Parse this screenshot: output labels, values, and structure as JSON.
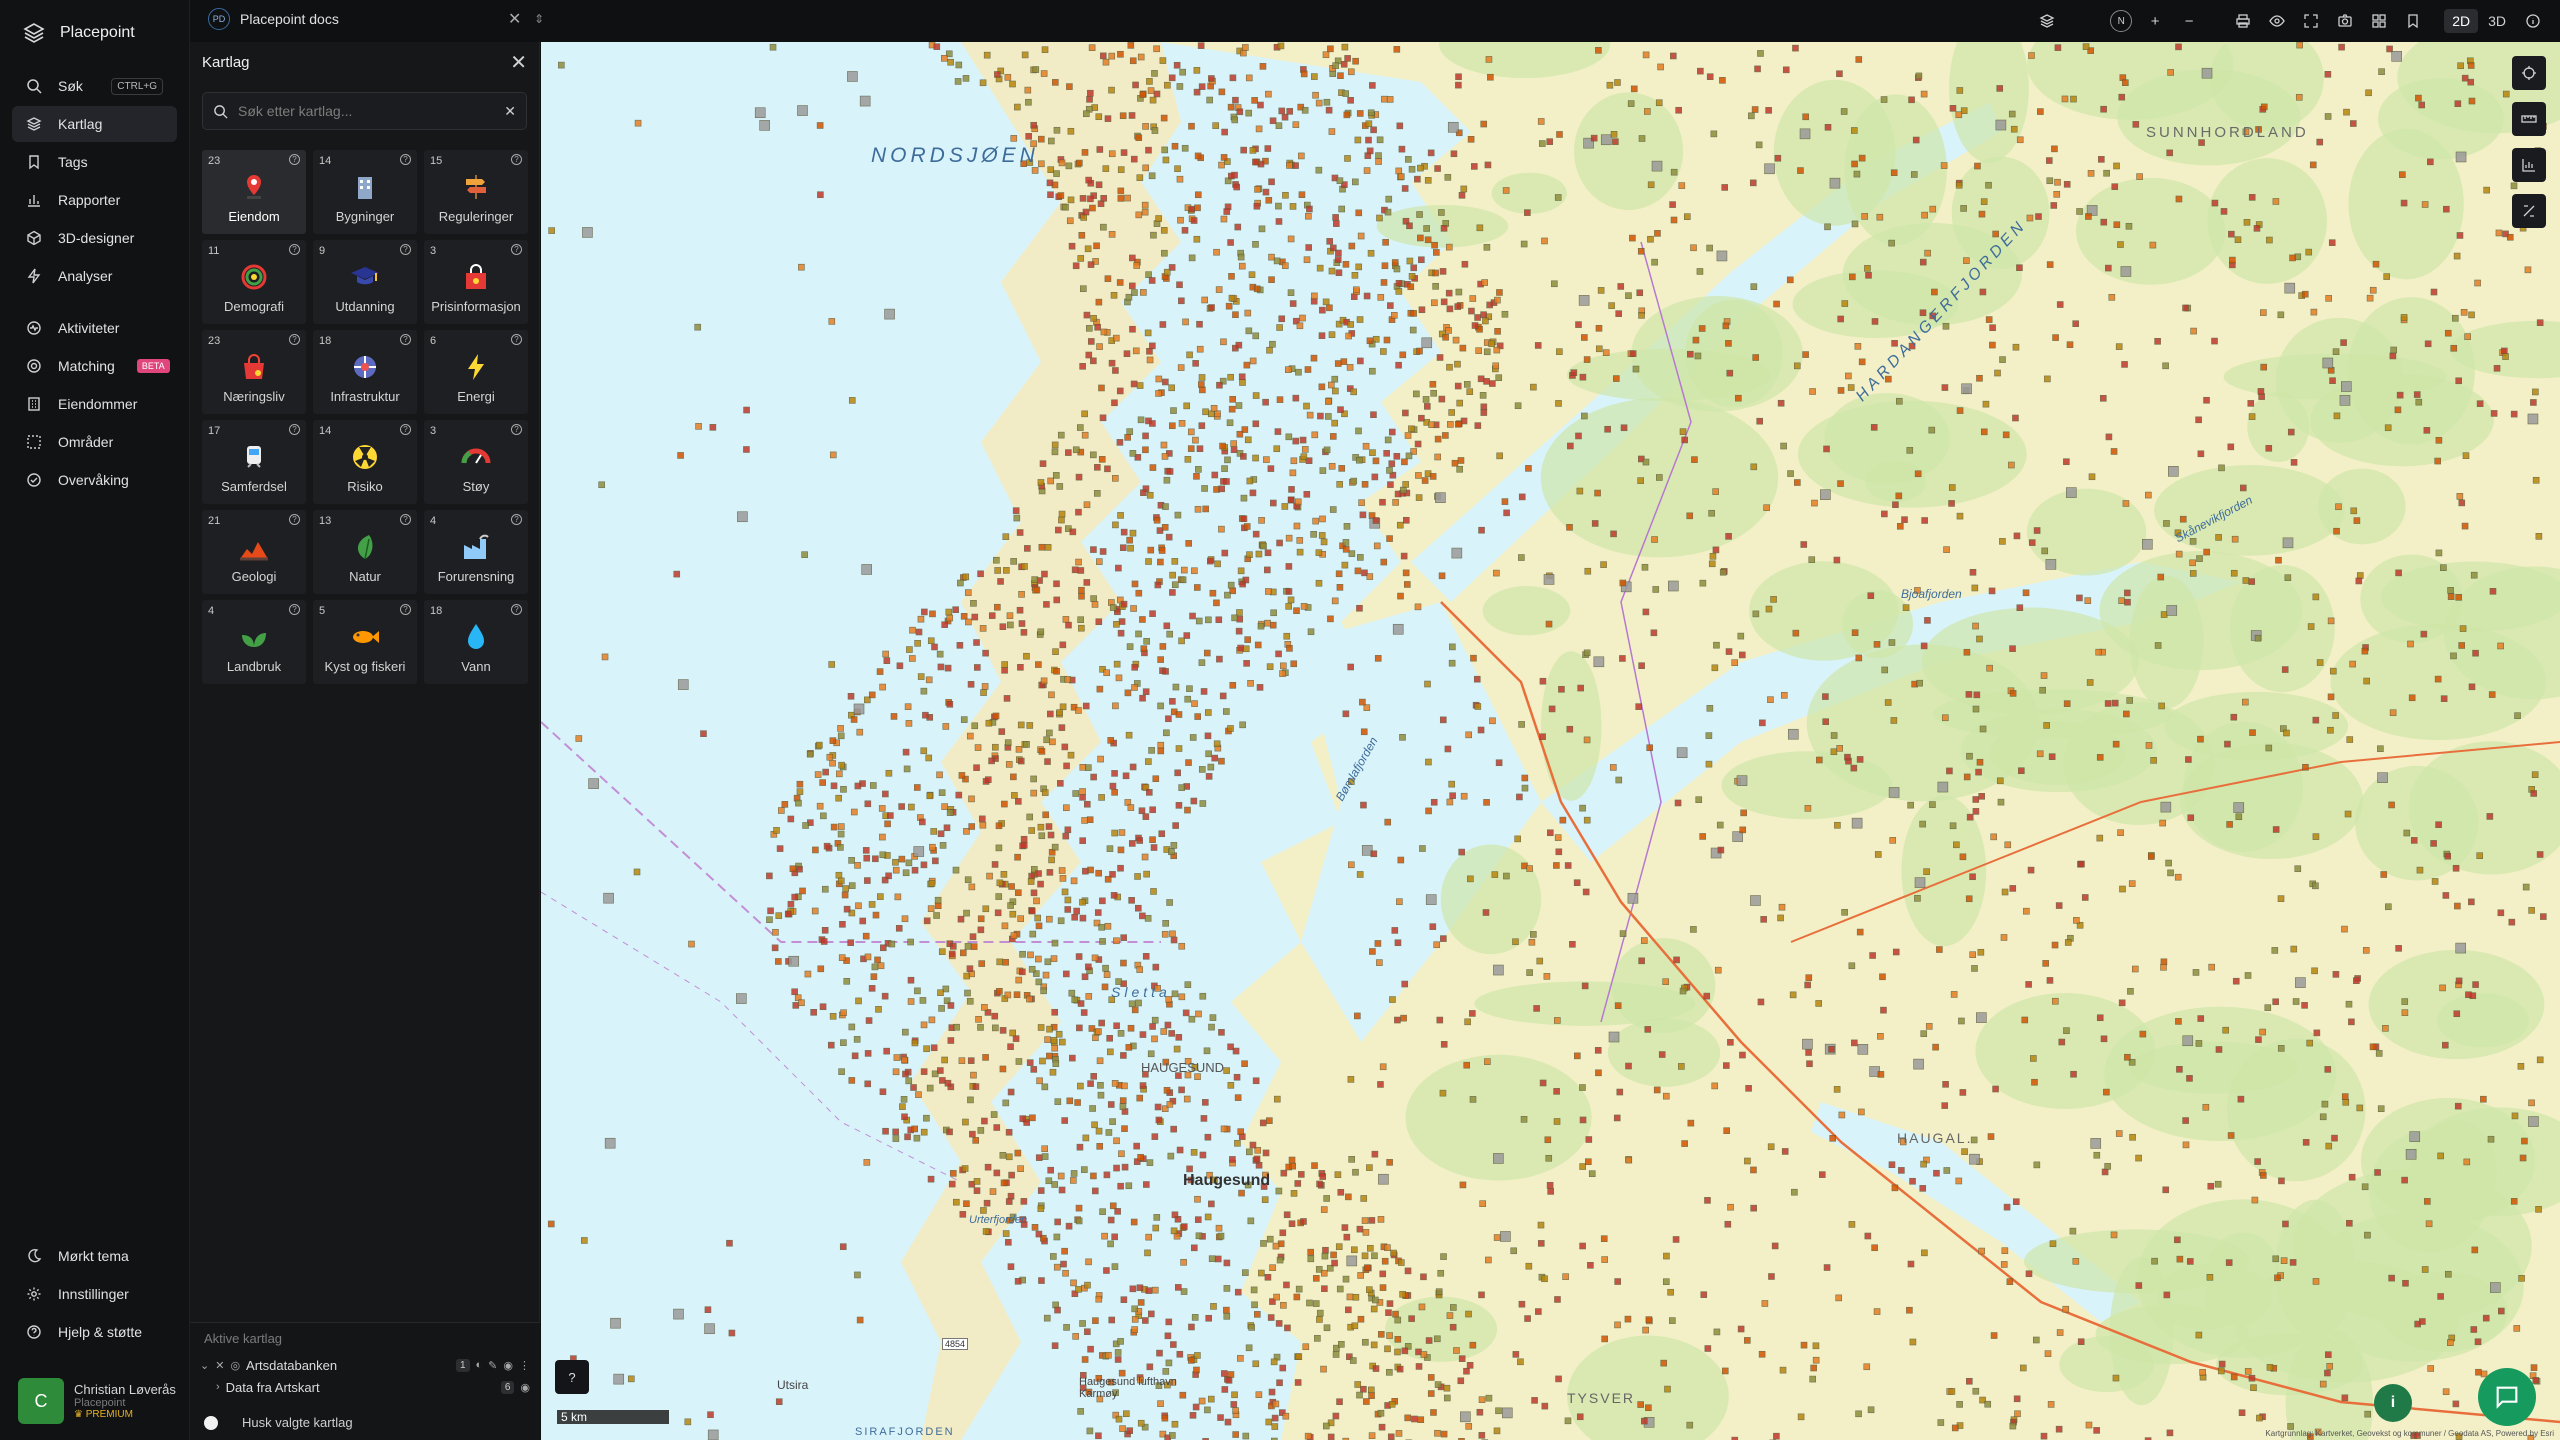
{
  "app": {
    "name": "Placepoint"
  },
  "nav": {
    "search": {
      "label": "Søk",
      "shortcut": "CTRL+G"
    },
    "items_top": [
      {
        "label": "Kartlag",
        "icon": "layers-icon",
        "active": true
      },
      {
        "label": "Tags",
        "icon": "bookmark-icon"
      },
      {
        "label": "Rapporter",
        "icon": "bar-chart-icon"
      },
      {
        "label": "3D-designer",
        "icon": "cube-icon"
      },
      {
        "label": "Analyser",
        "icon": "bolt-icon"
      }
    ],
    "items_mid": [
      {
        "label": "Aktiviteter",
        "icon": "activity-icon"
      },
      {
        "label": "Matching",
        "icon": "target-icon",
        "badge": "BETA"
      },
      {
        "label": "Eiendommer",
        "icon": "building-icon"
      },
      {
        "label": "Områder",
        "icon": "area-icon"
      },
      {
        "label": "Overvåking",
        "icon": "monitor-icon"
      }
    ],
    "items_bottom": [
      {
        "label": "Mørkt tema",
        "icon": "moon-icon"
      },
      {
        "label": "Innstillinger",
        "icon": "gear-icon"
      },
      {
        "label": "Hjelp & støtte",
        "icon": "help-icon"
      }
    ]
  },
  "user": {
    "initial": "C",
    "name": "Christian Løverås",
    "org": "Placepoint",
    "tier": "PREMIUM"
  },
  "topbar": {
    "doc_badge": "PD",
    "doc_name": "Placepoint docs",
    "compass": "N",
    "view_2d": "2D",
    "view_3d": "3D"
  },
  "panel": {
    "title": "Kartlag",
    "search_placeholder": "Søk etter kartlag...",
    "tiles": [
      {
        "count": "23",
        "label": "Eiendom",
        "icon": "pin-icon",
        "selected": true
      },
      {
        "count": "14",
        "label": "Bygninger",
        "icon": "building-icon"
      },
      {
        "count": "15",
        "label": "Reguleringer",
        "icon": "signpost-icon"
      },
      {
        "count": "11",
        "label": "Demografi",
        "icon": "demography-icon"
      },
      {
        "count": "9",
        "label": "Utdanning",
        "icon": "graduation-cap-icon"
      },
      {
        "count": "3",
        "label": "Prisinformasjon",
        "icon": "price-tag-icon"
      },
      {
        "count": "23",
        "label": "Næringsliv",
        "icon": "shopping-bag-icon"
      },
      {
        "count": "18",
        "label": "Infrastruktur",
        "icon": "network-icon"
      },
      {
        "count": "6",
        "label": "Energi",
        "icon": "lightning-icon"
      },
      {
        "count": "17",
        "label": "Samferdsel",
        "icon": "train-icon"
      },
      {
        "count": "14",
        "label": "Risiko",
        "icon": "radiation-icon"
      },
      {
        "count": "3",
        "label": "Støy",
        "icon": "gauge-icon"
      },
      {
        "count": "21",
        "label": "Geologi",
        "icon": "terrain-icon"
      },
      {
        "count": "13",
        "label": "Natur",
        "icon": "leaf-icon"
      },
      {
        "count": "4",
        "label": "Forurensning",
        "icon": "factory-icon"
      },
      {
        "count": "4",
        "label": "Landbruk",
        "icon": "sprout-icon"
      },
      {
        "count": "5",
        "label": "Kyst og fiskeri",
        "icon": "fish-icon"
      },
      {
        "count": "18",
        "label": "Vann",
        "icon": "water-drop-icon"
      }
    ],
    "active_title": "Aktive kartlag",
    "active_layer": {
      "name": "Artsdatabanken",
      "count": "1"
    },
    "sub_layer": {
      "name": "Data fra Artskart",
      "count": "6"
    },
    "remember_label": "Husk valgte kartlag"
  },
  "map": {
    "labels": {
      "sea": "NORDSJØEN",
      "sunnhordland": "SUNNHORDLAND",
      "hardanger": "HARDANGERFJORDEN",
      "sletta": "Sletta",
      "haugesund_upper": "HAUGESUND",
      "haugesund": "Haugesund",
      "bomlafjorden": "Bømlafjorden",
      "bjoafjorden": "Bjoafjorden",
      "skanevik": "Skånevikfjorden",
      "urterfjorden": "Urterfjorden",
      "utsira": "Utsira",
      "tysver": "TYSVER",
      "haugaland": "HAUGAL.",
      "sira": "SIRAFJORDEN",
      "haugesund_lufthavn": "Haugesund lufthavn Karmøy",
      "road_4854": "4854"
    },
    "scale": "5 km",
    "attribution": "Kartgrunnlag: Kartverket, Geovekst og kommuner / Geodata AS, Powered by Esri"
  }
}
